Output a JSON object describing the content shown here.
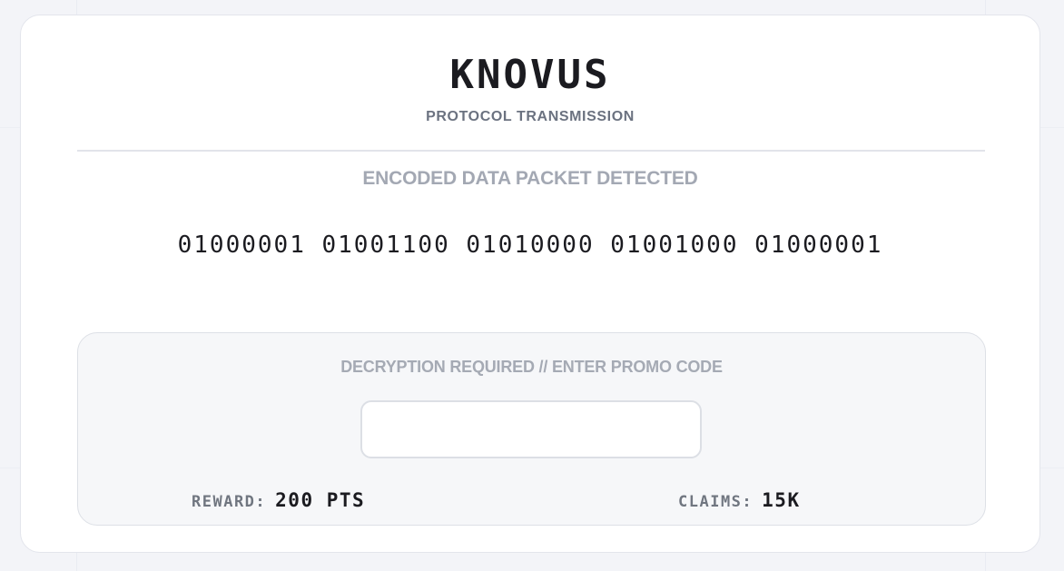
{
  "brand": {
    "name": "KNOVUS",
    "subtitle": "PROTOCOL TRANSMISSION"
  },
  "packet": {
    "label": "ENCODED DATA PACKET DETECTED",
    "binary": "01000001 01001100 01010000 01001000 01000001"
  },
  "decrypt": {
    "label": "DECRYPTION REQUIRED // ENTER PROMO CODE",
    "input_value": "",
    "input_placeholder": ""
  },
  "stats": {
    "reward_label": "REWARD:",
    "reward_value": "200 PTS",
    "claims_label": "CLAIMS:",
    "claims_value": "15K"
  },
  "colors": {
    "background": "#f3f4f8",
    "card": "#ffffff",
    "panel": "#f6f7f9",
    "text_dark": "#1b1b20",
    "text_muted": "#a3a8b3"
  }
}
